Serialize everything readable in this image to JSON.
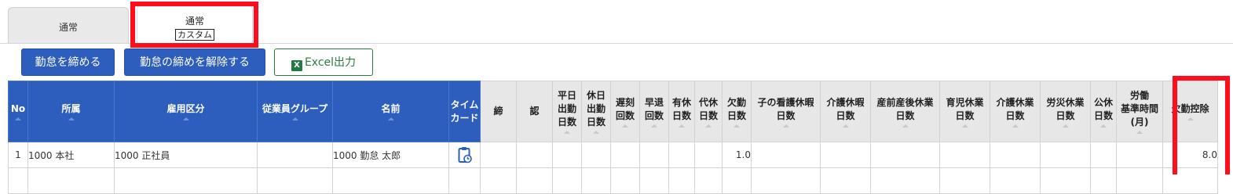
{
  "tabs": {
    "normal": "通常",
    "custom_top": "通常",
    "custom_bottom": "カスタム"
  },
  "toolbar": {
    "close_label": "勤怠を締める",
    "release_label": "勤怠の締めを解除する",
    "excel_label": "Excel出力",
    "excel_icon_letter": "X"
  },
  "columns": [
    {
      "key": "no",
      "label": "No",
      "style": "blue",
      "sortable": true
    },
    {
      "key": "dept",
      "label": "所属",
      "style": "blue",
      "sortable": true
    },
    {
      "key": "emptype",
      "label": "雇用区分",
      "style": "blue",
      "sortable": true
    },
    {
      "key": "group",
      "label": "従業員グループ",
      "style": "blue",
      "sortable": true
    },
    {
      "key": "name",
      "label": "名前",
      "style": "blue",
      "sortable": true
    },
    {
      "key": "card",
      "label": "タイム\nカード",
      "style": "blue",
      "sortable": false
    },
    {
      "key": "close",
      "label": "締",
      "style": "gray",
      "sortable": false
    },
    {
      "key": "approve",
      "label": "認",
      "style": "gray",
      "sortable": false
    },
    {
      "key": "weekday",
      "label": "平日\n出勤\n日数",
      "style": "gray",
      "sortable": true
    },
    {
      "key": "holiday",
      "label": "休日\n出勤\n日数",
      "style": "gray",
      "sortable": true
    },
    {
      "key": "late",
      "label": "遅刻\n回数",
      "style": "gray",
      "sortable": true
    },
    {
      "key": "early",
      "label": "早退\n回数",
      "style": "gray",
      "sortable": true
    },
    {
      "key": "paid",
      "label": "有休\n日数",
      "style": "gray",
      "sortable": true
    },
    {
      "key": "subst",
      "label": "代休\n日数",
      "style": "gray",
      "sortable": true
    },
    {
      "key": "absent",
      "label": "欠勤\n日数",
      "style": "gray",
      "sortable": true
    },
    {
      "key": "childcare",
      "label": "子の看護休暇\n日数",
      "style": "gray",
      "sortable": true
    },
    {
      "key": "nursing",
      "label": "介護休暇\n日数",
      "style": "gray",
      "sortable": true
    },
    {
      "key": "maternity",
      "label": "産前産後休業\n日数",
      "style": "gray",
      "sortable": true
    },
    {
      "key": "parental",
      "label": "育児休業\n日数",
      "style": "gray",
      "sortable": true
    },
    {
      "key": "carework",
      "label": "介護休業\n日数",
      "style": "gray",
      "sortable": true
    },
    {
      "key": "injury",
      "label": "労災休業\n日数",
      "style": "gray",
      "sortable": true
    },
    {
      "key": "public",
      "label": "公休\n日数",
      "style": "gray",
      "sortable": true
    },
    {
      "key": "basehours",
      "label": "労働\n基準時間\n(月)",
      "style": "gray",
      "sortable": true
    },
    {
      "key": "deduction",
      "label": "欠勤控除",
      "style": "gray",
      "sortable": true
    }
  ],
  "rows": [
    {
      "no": "1",
      "dept": "1000 本社",
      "emptype": "1000 正社員",
      "group": "",
      "name": "1000 勤怠 太郎",
      "card": "timecard-icon",
      "close": "",
      "approve": "",
      "weekday": "",
      "holiday": "",
      "late": "",
      "early": "",
      "paid": "",
      "subst": "",
      "absent": "1.0",
      "childcare": "",
      "nursing": "",
      "maternity": "",
      "parental": "",
      "carework": "",
      "injury": "",
      "public": "",
      "basehours": "",
      "deduction": "8.0"
    }
  ],
  "colors": {
    "header_blue": "#2d5ebe",
    "header_gray": "#e7e7e7",
    "highlight_red": "#ff0d1c",
    "excel_green": "#2b7a3f"
  }
}
